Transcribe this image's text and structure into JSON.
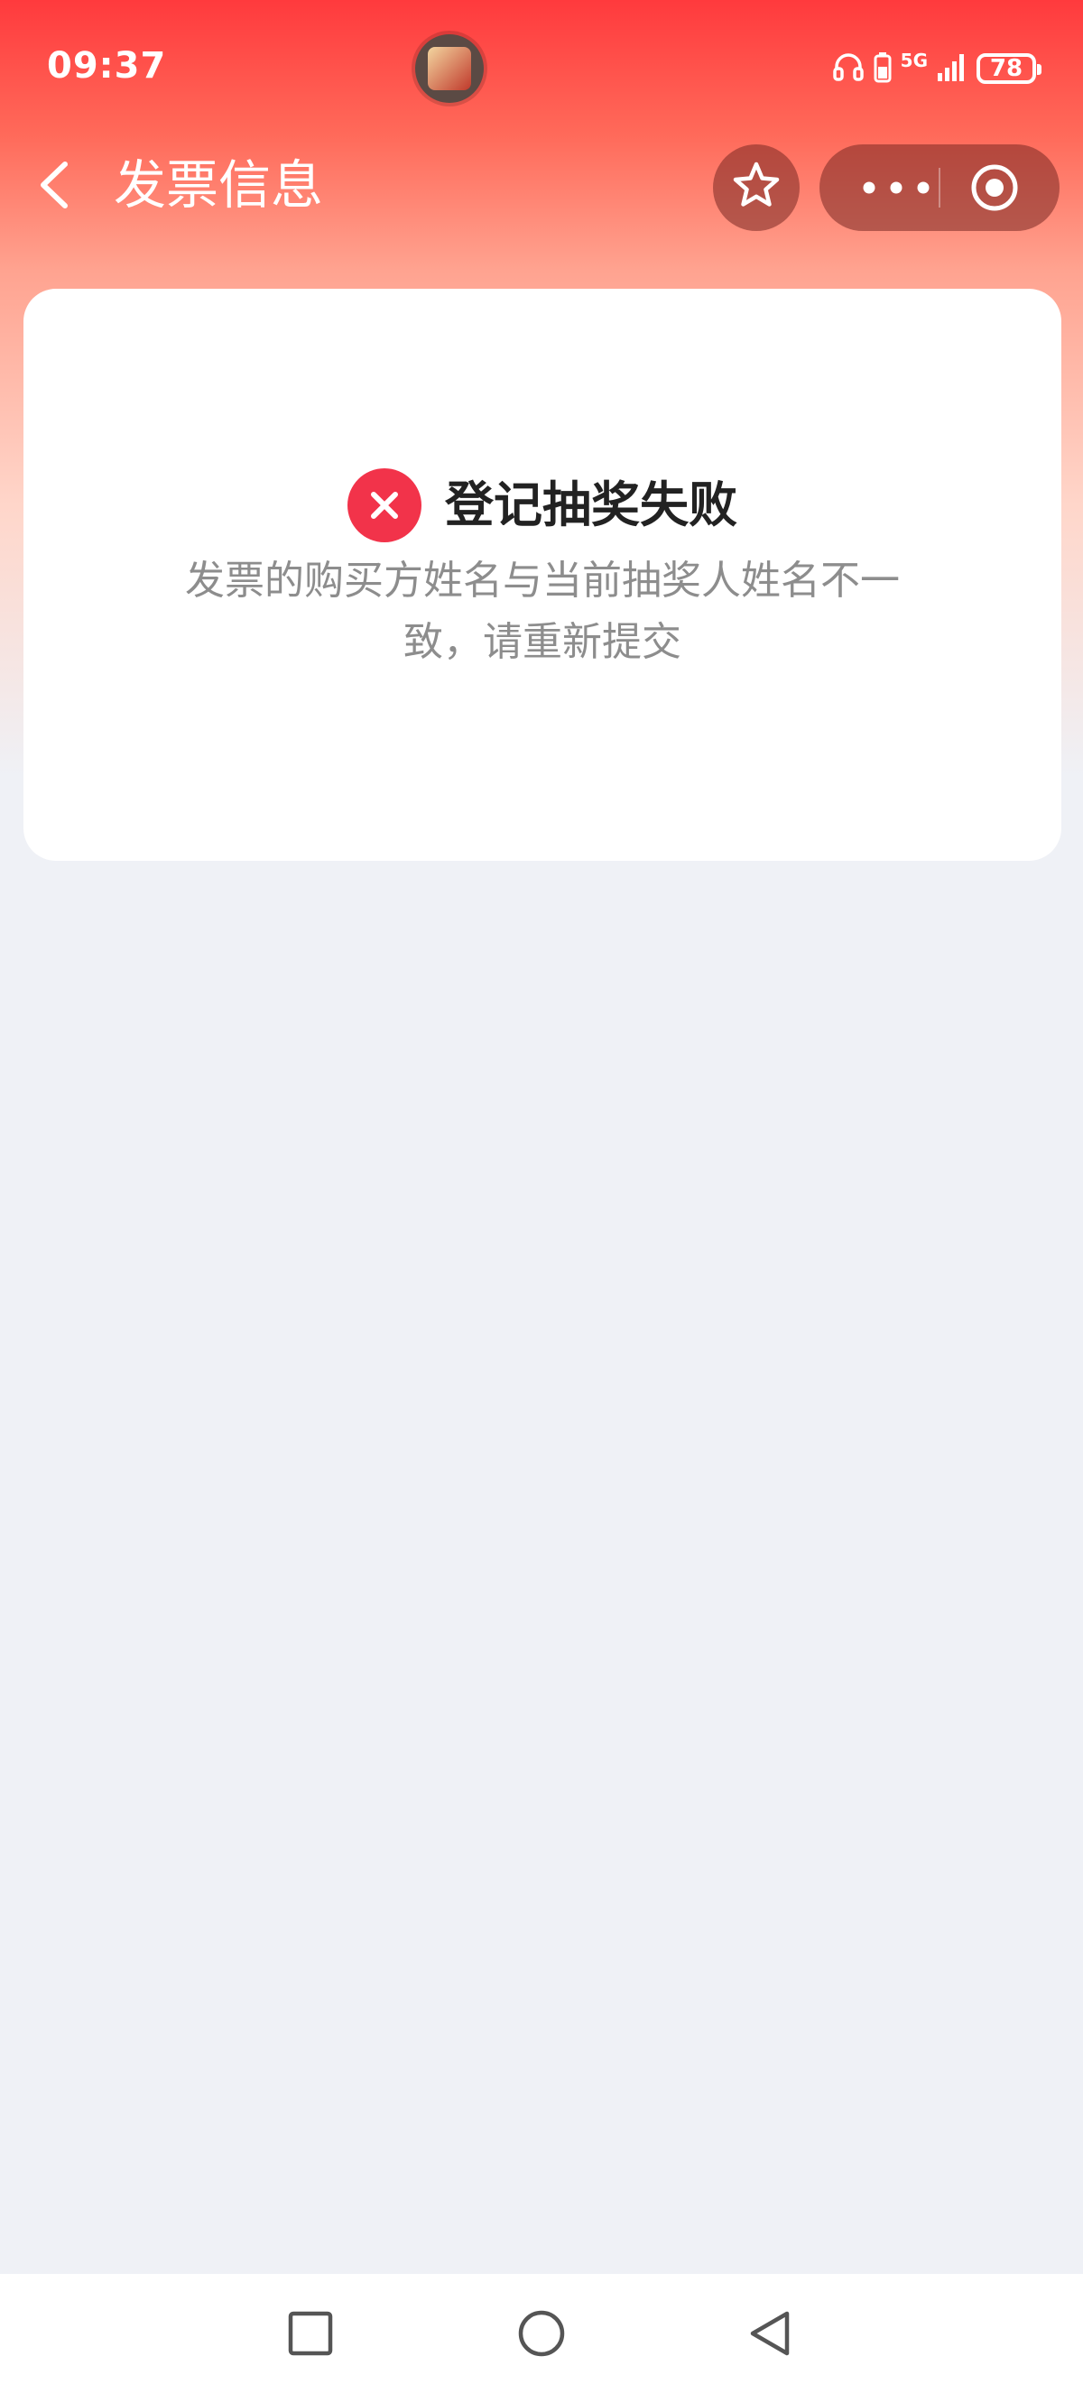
{
  "status_bar": {
    "time": "09:37",
    "network": "5G",
    "battery": "78",
    "icons": [
      "headphones-icon",
      "battery-saver-icon",
      "signal-icon",
      "battery-icon"
    ]
  },
  "nav": {
    "title": "发票信息",
    "back_icon": "chevron-left-icon",
    "favorite_icon": "star-icon",
    "more_icon": "more-dots-icon",
    "close_icon": "target-icon"
  },
  "result": {
    "status_icon": "close-circle-icon",
    "title": "登记抽奖失败",
    "description": "发票的购买方姓名与当前抽奖人姓名不一致，请重新提交"
  },
  "system_nav": {
    "icons": [
      "square-icon",
      "circle-icon",
      "triangle-back-icon"
    ]
  },
  "colors": {
    "header_red": "#ff3a3d",
    "error_red": "#f2334a",
    "page_bg": "#eff1f6"
  }
}
